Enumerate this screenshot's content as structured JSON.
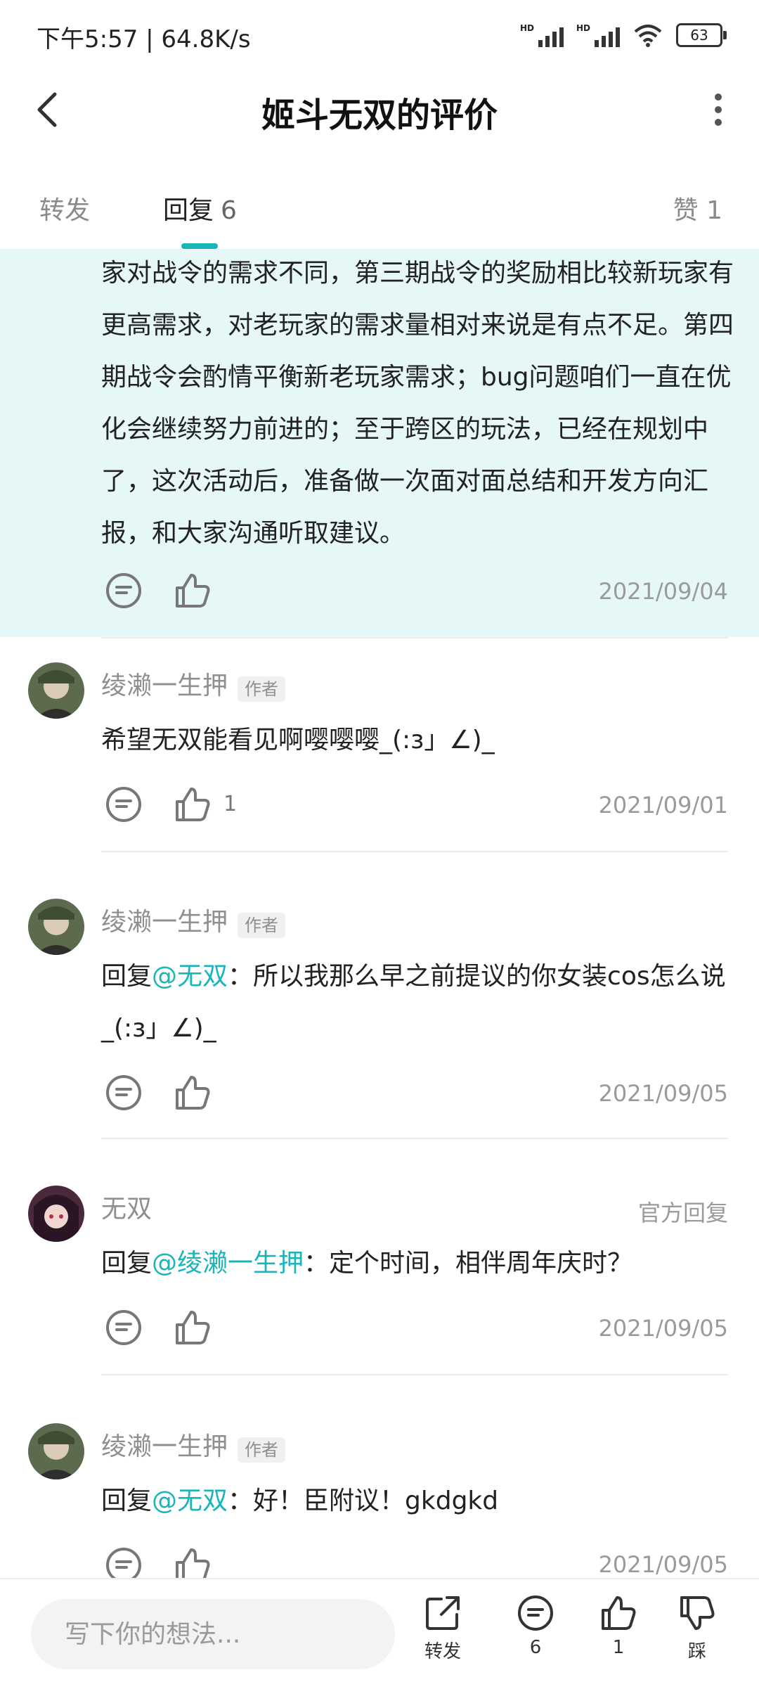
{
  "status_bar": {
    "time": "下午5:57 | 64.8K/s",
    "battery": "63"
  },
  "header": {
    "title": "姬斗无双的评价"
  },
  "tabs": {
    "repost": "转发",
    "reply": "回复",
    "reply_count": "6",
    "like": "赞 1"
  },
  "highlight": {
    "text": "家对战令的需求不同，第三期战令的奖励相比较新玩家有更高需求，对老玩家的需求量相对来说是有点不足。第四期战令会酌情平衡新老玩家需求；bug问题咱们一直在优化会继续努力前进的；至于跨区的玩法，已经在规划中了，这次活动后，准备做一次面对面总结和开发方向汇报，和大家沟通听取建议。",
    "date": "2021/09/04"
  },
  "replies": [
    {
      "name": "绫濑一生押",
      "badge": "作者",
      "prefix": "",
      "mention": "",
      "text": "希望无双能看见啊嘤嘤嘤_(:з」∠)_",
      "likes": "1",
      "date": "2021/09/01"
    },
    {
      "name": "绫濑一生押",
      "badge": "作者",
      "prefix": "回复",
      "mention": "@无双",
      "text": "：所以我那么早之前提议的你女装cos怎么说_(:з」∠)_",
      "likes": "",
      "date": "2021/09/05"
    },
    {
      "name": "无双",
      "official": "官方回复",
      "prefix": "回复",
      "mention": "@绫濑一生押",
      "text": "：定个时间，相伴周年庆时？",
      "likes": "",
      "date": "2021/09/05"
    },
    {
      "name": "绫濑一生押",
      "badge": "作者",
      "prefix": "回复",
      "mention": "@无双",
      "text": "：好！臣附议！gkdgkd",
      "likes": "",
      "date": "2021/09/05"
    }
  ],
  "bottom_bar": {
    "input_placeholder": "写下你的想法...",
    "repost_label": "转发",
    "comment_count": "6",
    "like_count": "1",
    "dislike_label": "踩"
  },
  "colors": {
    "accent": "#1ab5b8",
    "highlight_bg": "#e6f7f7"
  },
  "icons": [
    "back-arrow-icon",
    "more-vertical-icon",
    "comment-icon",
    "thumbs-up-icon",
    "share-icon",
    "thumbs-down-icon"
  ]
}
